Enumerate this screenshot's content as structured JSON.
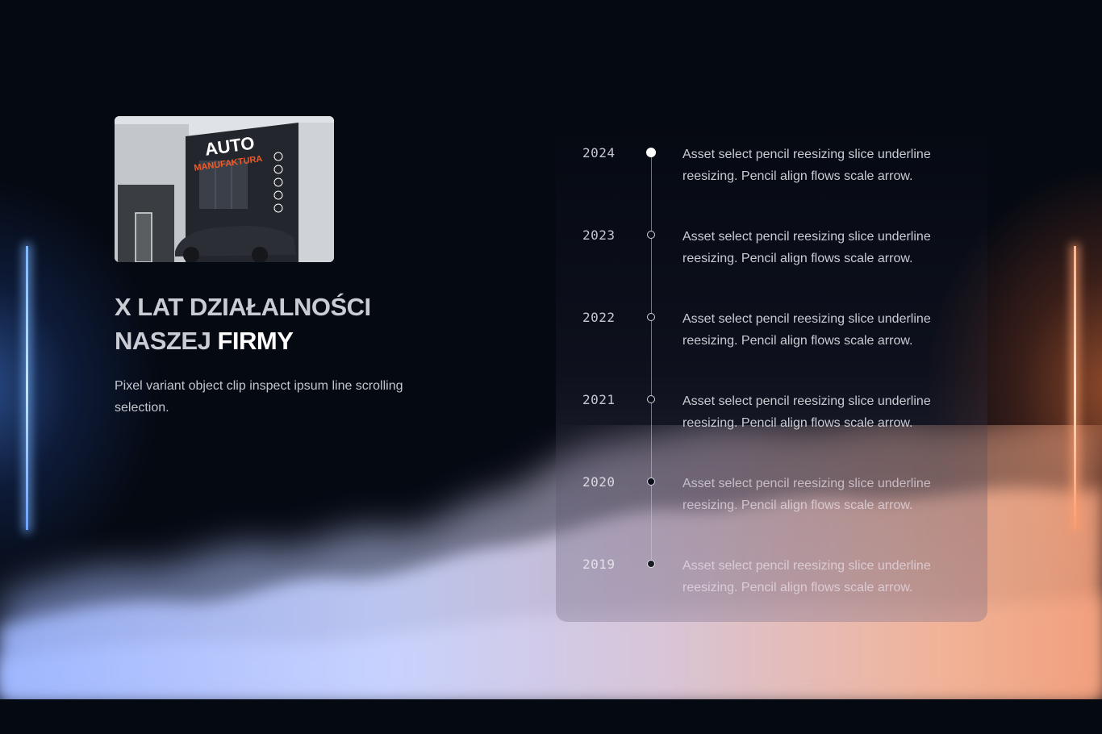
{
  "hero": {
    "image": {
      "alt": "",
      "sign_main": "AUTO",
      "sign_sub": "MANUFAKTURA"
    },
    "heading_line1": "X LAT DZIAŁALNOŚCI",
    "heading_line2_plain": "NASZEJ",
    "heading_line2_accent": "FIRMY",
    "description": "Pixel variant object clip inspect ipsum line scrolling selection."
  },
  "timeline": {
    "items": [
      {
        "year": "2024",
        "text": "Asset select pencil reesizing slice underline reesizing. Pencil align flows scale arrow.",
        "marker": "filled"
      },
      {
        "year": "2023",
        "text": "Asset select pencil reesizing slice underline reesizing. Pencil align flows scale arrow.",
        "marker": "outline"
      },
      {
        "year": "2022",
        "text": "Asset select pencil reesizing slice underline reesizing. Pencil align flows scale arrow.",
        "marker": "outline"
      },
      {
        "year": "2021",
        "text": "Asset select pencil reesizing slice underline reesizing. Pencil align flows scale arrow.",
        "marker": "outline"
      },
      {
        "year": "2020",
        "text": "Asset select pencil reesizing slice underline reesizing. Pencil align flows scale arrow.",
        "marker": "outline"
      },
      {
        "year": "2019",
        "text": "Asset select pencil reesizing slice underline reesizing. Pencil align flows scale arrow.",
        "marker": "dark"
      }
    ]
  },
  "colors": {
    "background": "#050912",
    "glow_left": "#7fb6ff",
    "glow_right": "#ffb38a",
    "brand_accent": "#f05a28"
  }
}
